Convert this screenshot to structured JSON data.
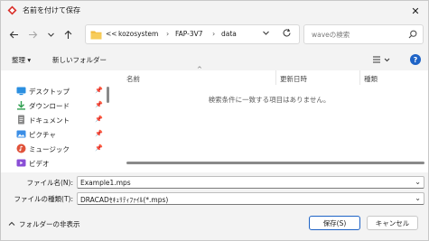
{
  "window": {
    "title": "名前を付けて保存",
    "close_symbol": "✕",
    "accent_color": "#1e63c6"
  },
  "nav": {
    "back_icon": "back-arrow-icon",
    "forward_icon": "forward-arrow-icon",
    "up_dropdown_icon": "chevron-down-icon",
    "up_icon": "up-arrow-icon",
    "breadcrumb": {
      "overflow": "<<",
      "items": [
        "kozosystem",
        "FAP-3V7",
        "data"
      ]
    },
    "search_placeholder": "waveの検索"
  },
  "toolbar": {
    "organize_label": "整理 ▾",
    "new_folder_label": "新しいフォルダー"
  },
  "sidebar": {
    "items": [
      {
        "label": "デスクトップ",
        "icon": "desktop-icon",
        "color": "#2b8fe0"
      },
      {
        "label": "ダウンロード",
        "icon": "download-icon",
        "color": "#2e9e4f"
      },
      {
        "label": "ドキュメント",
        "icon": "document-icon",
        "color": "#7a7a7a"
      },
      {
        "label": "ピクチャ",
        "icon": "picture-icon",
        "color": "#3a8ee6"
      },
      {
        "label": "ミュージック",
        "icon": "music-icon",
        "color": "#e0533b"
      },
      {
        "label": "ビデオ",
        "icon": "video-icon",
        "color": "#8a4fd6"
      }
    ]
  },
  "filelist": {
    "columns": [
      "名前",
      "更新日時",
      "種類"
    ],
    "empty_message": "検索条件に一致する項目はありません。"
  },
  "form": {
    "filename_label": "ファイル名(N):",
    "filename_value": "Example1.mps",
    "filetype_label": "ファイルの種類(T):",
    "filetype_value": "DRACADｾｷｭﾘﾃｨﾌｧｲﾙ(*.mps)"
  },
  "footer": {
    "hide_folders_label": "フォルダーの非表示",
    "save_label": "保存(S)",
    "cancel_label": "キャンセル"
  }
}
